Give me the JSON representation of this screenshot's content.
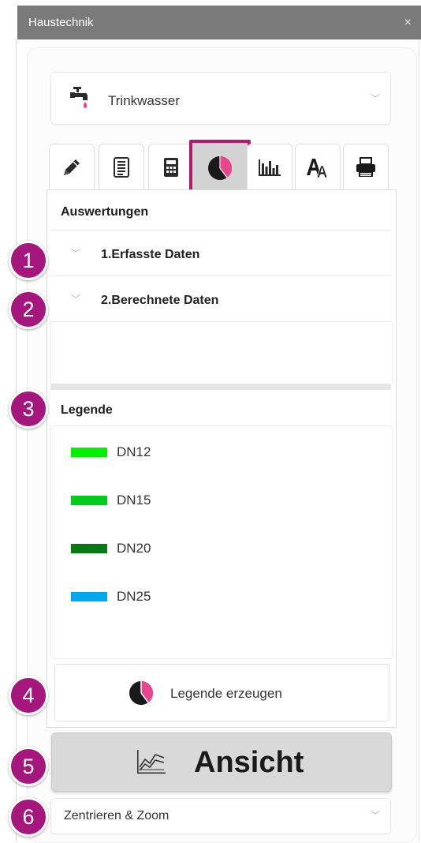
{
  "window": {
    "title": "Haustechnik",
    "close_glyph": "×"
  },
  "category_dropdown": {
    "value": "Trinkwasser",
    "icon": "faucet-icon"
  },
  "tabs": [
    {
      "name": "edit",
      "icon": "pencil-icon"
    },
    {
      "name": "list",
      "icon": "document-list-icon"
    },
    {
      "name": "calculate",
      "icon": "calculator-icon"
    },
    {
      "name": "evaluations",
      "icon": "pie-chart-icon",
      "active": true
    },
    {
      "name": "statistics",
      "icon": "bar-chart-icon"
    },
    {
      "name": "text",
      "icon": "font-icon"
    },
    {
      "name": "print",
      "icon": "printer-icon"
    }
  ],
  "evaluations": {
    "title": "Auswertungen",
    "items": [
      {
        "label": "1.Erfasste Daten"
      },
      {
        "label": "2.Berechnete Daten"
      }
    ]
  },
  "legend": {
    "title": "Legende",
    "items": [
      {
        "label": "DN12",
        "color": "#00f000"
      },
      {
        "label": "DN15",
        "color": "#00cc1a"
      },
      {
        "label": "DN20",
        "color": "#067a13"
      },
      {
        "label": "DN25",
        "color": "#00a8ec"
      }
    ],
    "create_button": "Legende erzeugen"
  },
  "view_button": {
    "label": "Ansicht"
  },
  "zoom_dropdown": {
    "value": "Zentrieren & Zoom"
  },
  "callouts": [
    "1",
    "2",
    "3",
    "4",
    "5",
    "6"
  ],
  "colors": {
    "accent": "#a5177c",
    "pie_pink": "#e8458f",
    "titlebar": "#7a7a7a"
  }
}
